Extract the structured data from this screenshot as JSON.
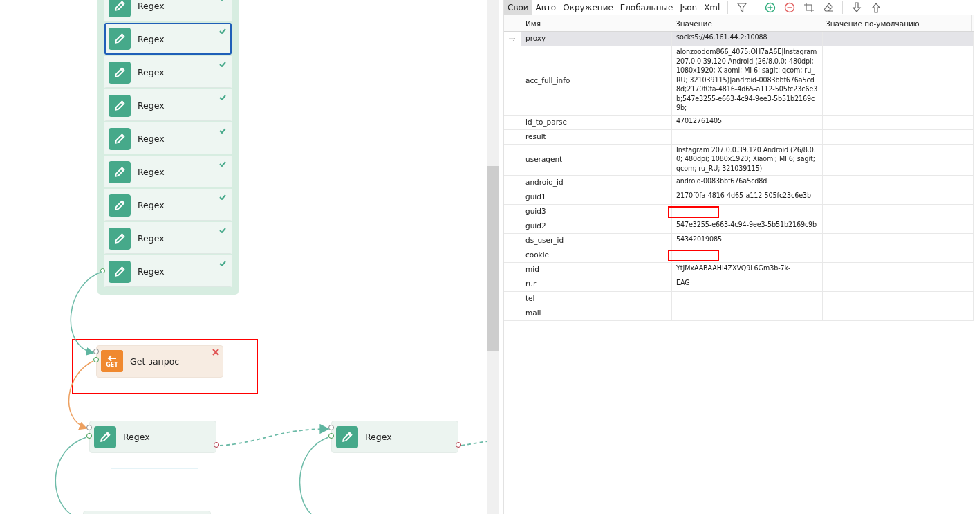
{
  "canvas": {
    "group": {
      "items": [
        {
          "label": "Regex",
          "selected": false,
          "checked": true
        },
        {
          "label": "Regex",
          "selected": true,
          "checked": true
        },
        {
          "label": "Regex",
          "selected": false,
          "checked": true
        },
        {
          "label": "Regex",
          "selected": false,
          "checked": true
        },
        {
          "label": "Regex",
          "selected": false,
          "checked": true
        },
        {
          "label": "Regex",
          "selected": false,
          "checked": true
        },
        {
          "label": "Regex",
          "selected": false,
          "checked": true
        },
        {
          "label": "Regex",
          "selected": false,
          "checked": true
        },
        {
          "label": "Regex",
          "selected": false,
          "checked": true
        }
      ]
    },
    "nodes": [
      {
        "kind": "get",
        "label": "Get запрос",
        "icon_text": "GET",
        "marked": true
      },
      {
        "kind": "regex",
        "label": "Regex"
      },
      {
        "kind": "regex",
        "label": "Regex"
      }
    ]
  },
  "tabs": [
    {
      "label": "Свои",
      "selected": true
    },
    {
      "label": "Авто",
      "selected": false
    },
    {
      "label": "Окружение",
      "selected": false
    },
    {
      "label": "Глобальные",
      "selected": false
    },
    {
      "label": "Json",
      "selected": false
    },
    {
      "label": "Xml",
      "selected": false
    }
  ],
  "table": {
    "columns": [
      "Имя",
      "Значение",
      "Значение по-умолчанию"
    ],
    "rows": [
      {
        "name": "proxy",
        "value": "socks5://46.161.44.2:10088",
        "selected": true,
        "marked": false
      },
      {
        "name": "acc_full_info",
        "value": "alonzoodom866_4075:OH7aA6E|Instagram 207.0.0.39.120 Android (26/8.0.0; 480dpi; 1080x1920; Xiaomi; MI 6; sagit; qcom; ru_RU; 321039115)|android-0083bbf676a5cd8d;2170f0fa-4816-4d65-a112-505fc23c6e3b;547e3255-e663-4c94-9ee3-5b51b2169c9b;",
        "selected": false,
        "marked": false
      },
      {
        "name": "id_to_parse",
        "value": "47012761405",
        "selected": false,
        "marked": false
      },
      {
        "name": "result",
        "value": "",
        "selected": false,
        "marked": false
      },
      {
        "name": "useragent",
        "value": "Instagram 207.0.0.39.120 Android (26/8.0.0; 480dpi; 1080x1920; Xiaomi; MI 6; sagit; qcom; ru_RU; 321039115)",
        "selected": false,
        "marked": false
      },
      {
        "name": "android_id",
        "value": "android-0083bbf676a5cd8d",
        "selected": false,
        "marked": false
      },
      {
        "name": "guid1",
        "value": "2170f0fa-4816-4d65-a112-505fc23c6e3b",
        "selected": false,
        "marked": false
      },
      {
        "name": "guid3",
        "value": "",
        "selected": false,
        "marked": true
      },
      {
        "name": "guid2",
        "value": "547e3255-e663-4c94-9ee3-5b51b2169c9b",
        "selected": false,
        "marked": false
      },
      {
        "name": "ds_user_id",
        "value": "54342019085",
        "selected": false,
        "marked": false
      },
      {
        "name": "cookie",
        "value": "",
        "selected": false,
        "marked": true
      },
      {
        "name": "mid",
        "value": "YtJMxAABAAHi4ZXVQ9L6Gm3b-7k-",
        "selected": false,
        "marked": false
      },
      {
        "name": "rur",
        "value": "EAG",
        "selected": false,
        "marked": false
      },
      {
        "name": "tel",
        "value": "",
        "selected": false,
        "marked": false
      },
      {
        "name": "mail",
        "value": "",
        "selected": false,
        "marked": false
      }
    ]
  }
}
